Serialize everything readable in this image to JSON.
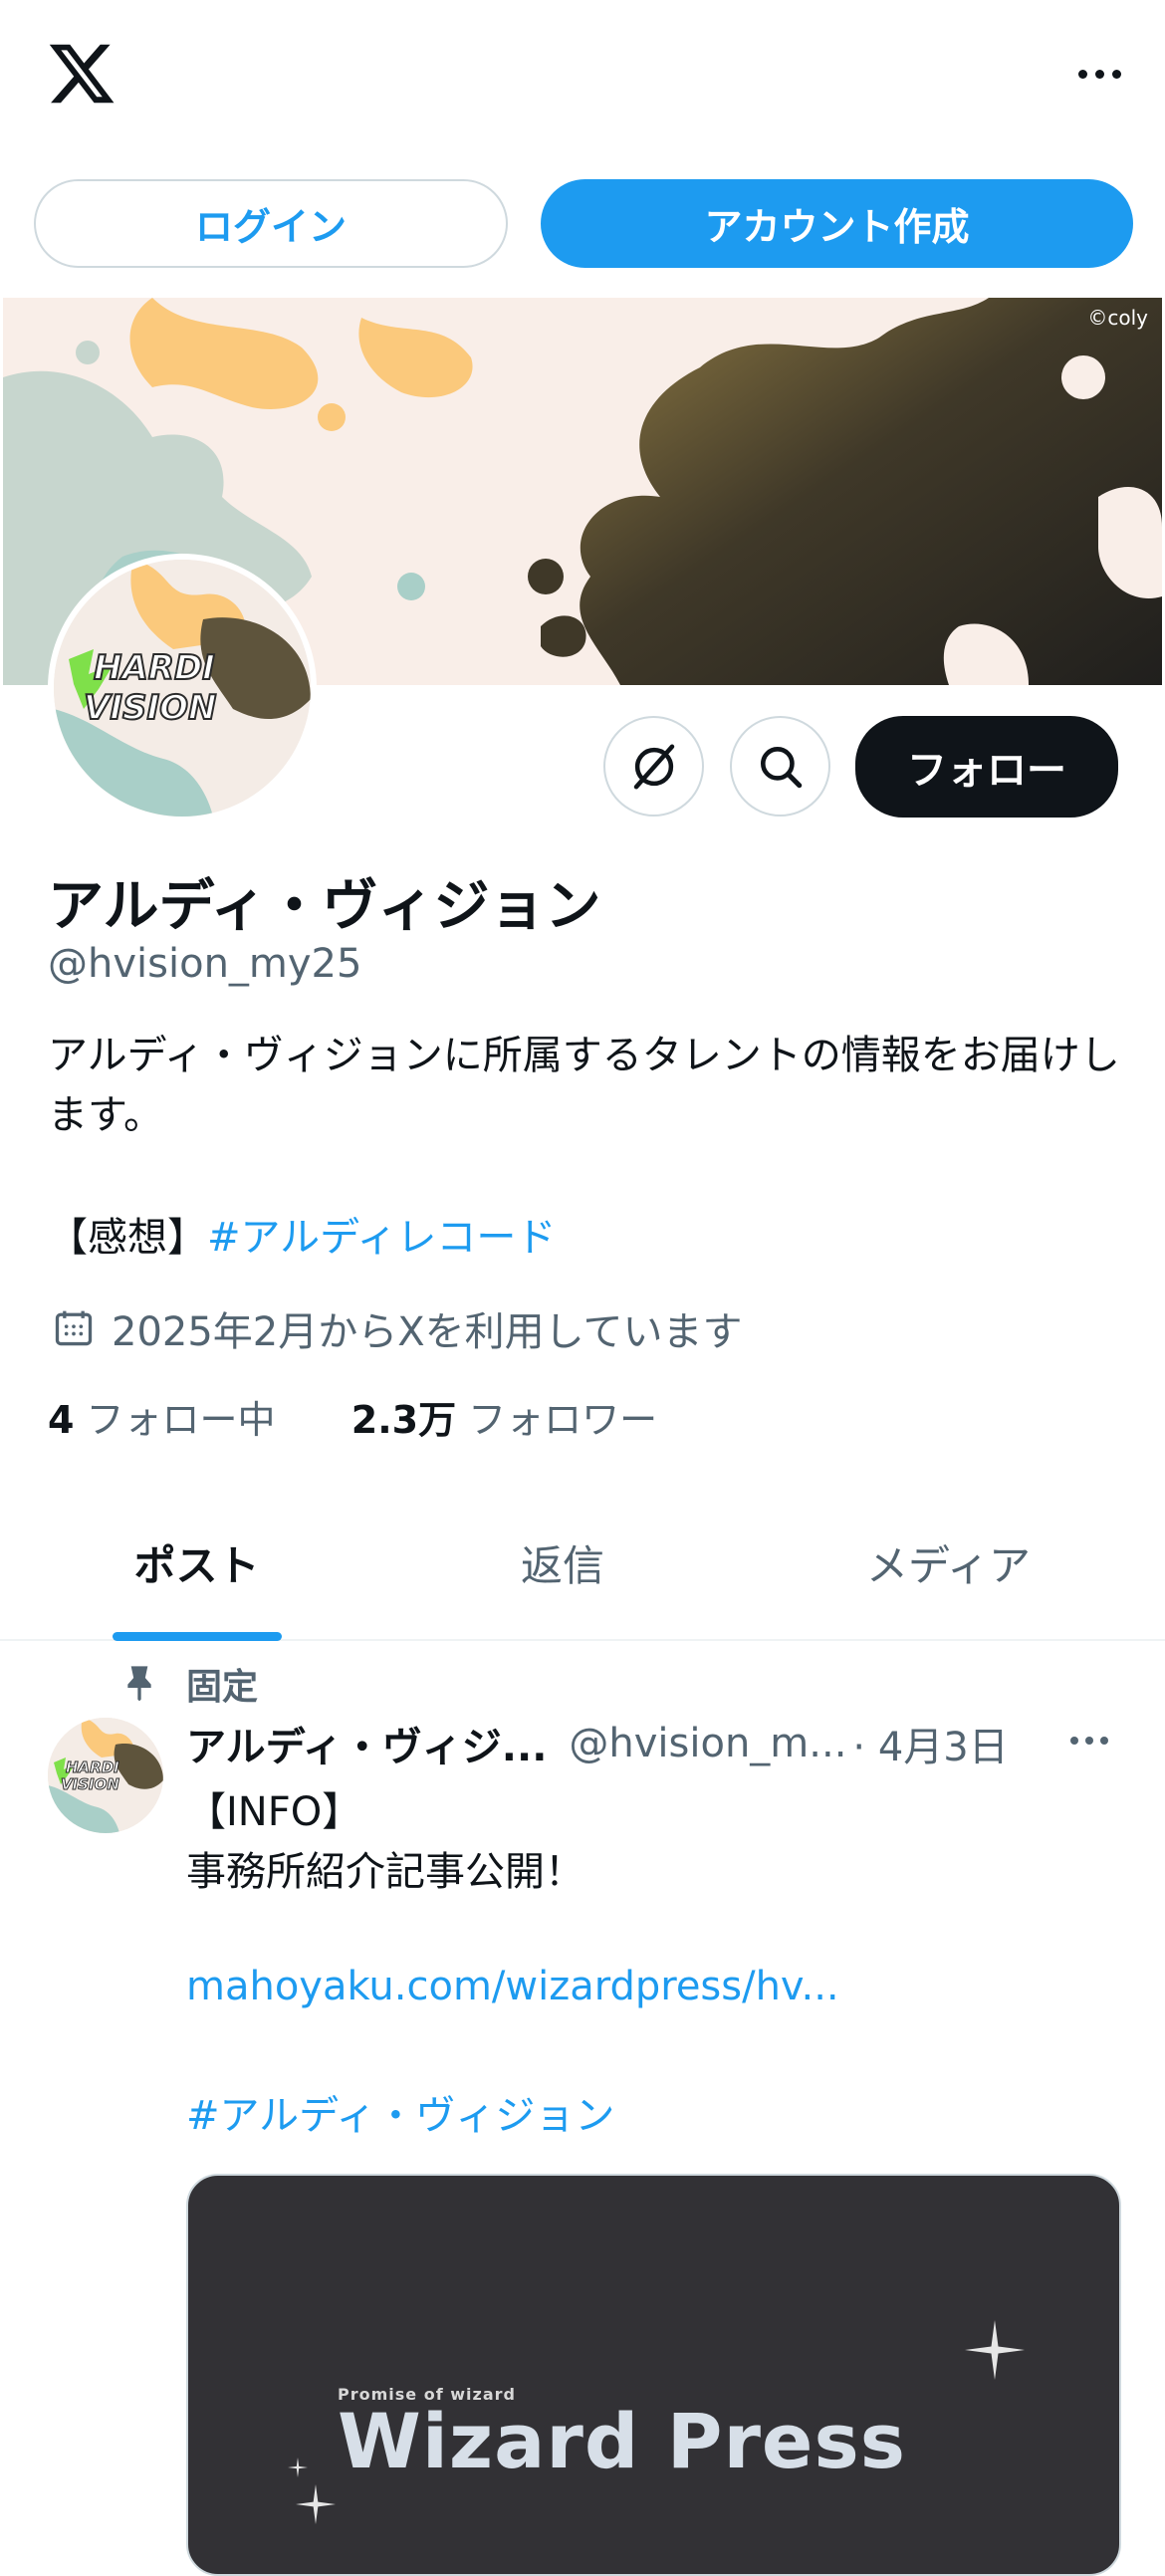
{
  "topbar": {
    "logo_icon": "x-logo-icon",
    "more_icon": "more-horizontal-icon"
  },
  "auth": {
    "login_label": "ログイン",
    "signup_label": "アカウント作成"
  },
  "banner": {
    "copyright": "©coly"
  },
  "avatar": {
    "logo_text_line1": "HARDI",
    "logo_text_line2": "VISION"
  },
  "actions": {
    "grok_icon": "grok-icon",
    "search_icon": "search-icon",
    "follow_label": "フォロー"
  },
  "profile": {
    "display_name": "アルディ・ヴィジョン",
    "handle": "@hvision_my25",
    "bio": "アルディ・ヴィジョンに所属するタレントの情報をお届けします。",
    "bio_tag_prefix": "【感想】",
    "bio_hashtag": "#アルディレコード",
    "joined": "2025年2月からXを利用しています",
    "following_count": "4",
    "following_label": "フォロー中",
    "followers_count": "2.3万",
    "followers_label": "フォロワー"
  },
  "tabs": [
    {
      "label": "ポスト",
      "active": true
    },
    {
      "label": "返信",
      "active": false
    },
    {
      "label": "メディア",
      "active": false
    }
  ],
  "pinned_tweet": {
    "pinned_label": "固定",
    "author_name": "アルディ・ヴィジ...",
    "author_handle": "@hvision_m...",
    "date": "· 4月3日",
    "text": "【INFO】\n事務所紹介記事公開！",
    "link": "mahoyaku.com/wizardpress/hv...",
    "hashtag": "#アルディ・ヴィジョン",
    "media": {
      "subtitle": "Promise of wizard",
      "title": "Wizard Press"
    }
  },
  "colors": {
    "accent": "#1d9bf0",
    "text": "#0f1419",
    "secondary": "#536471",
    "border": "#cfd9de"
  }
}
